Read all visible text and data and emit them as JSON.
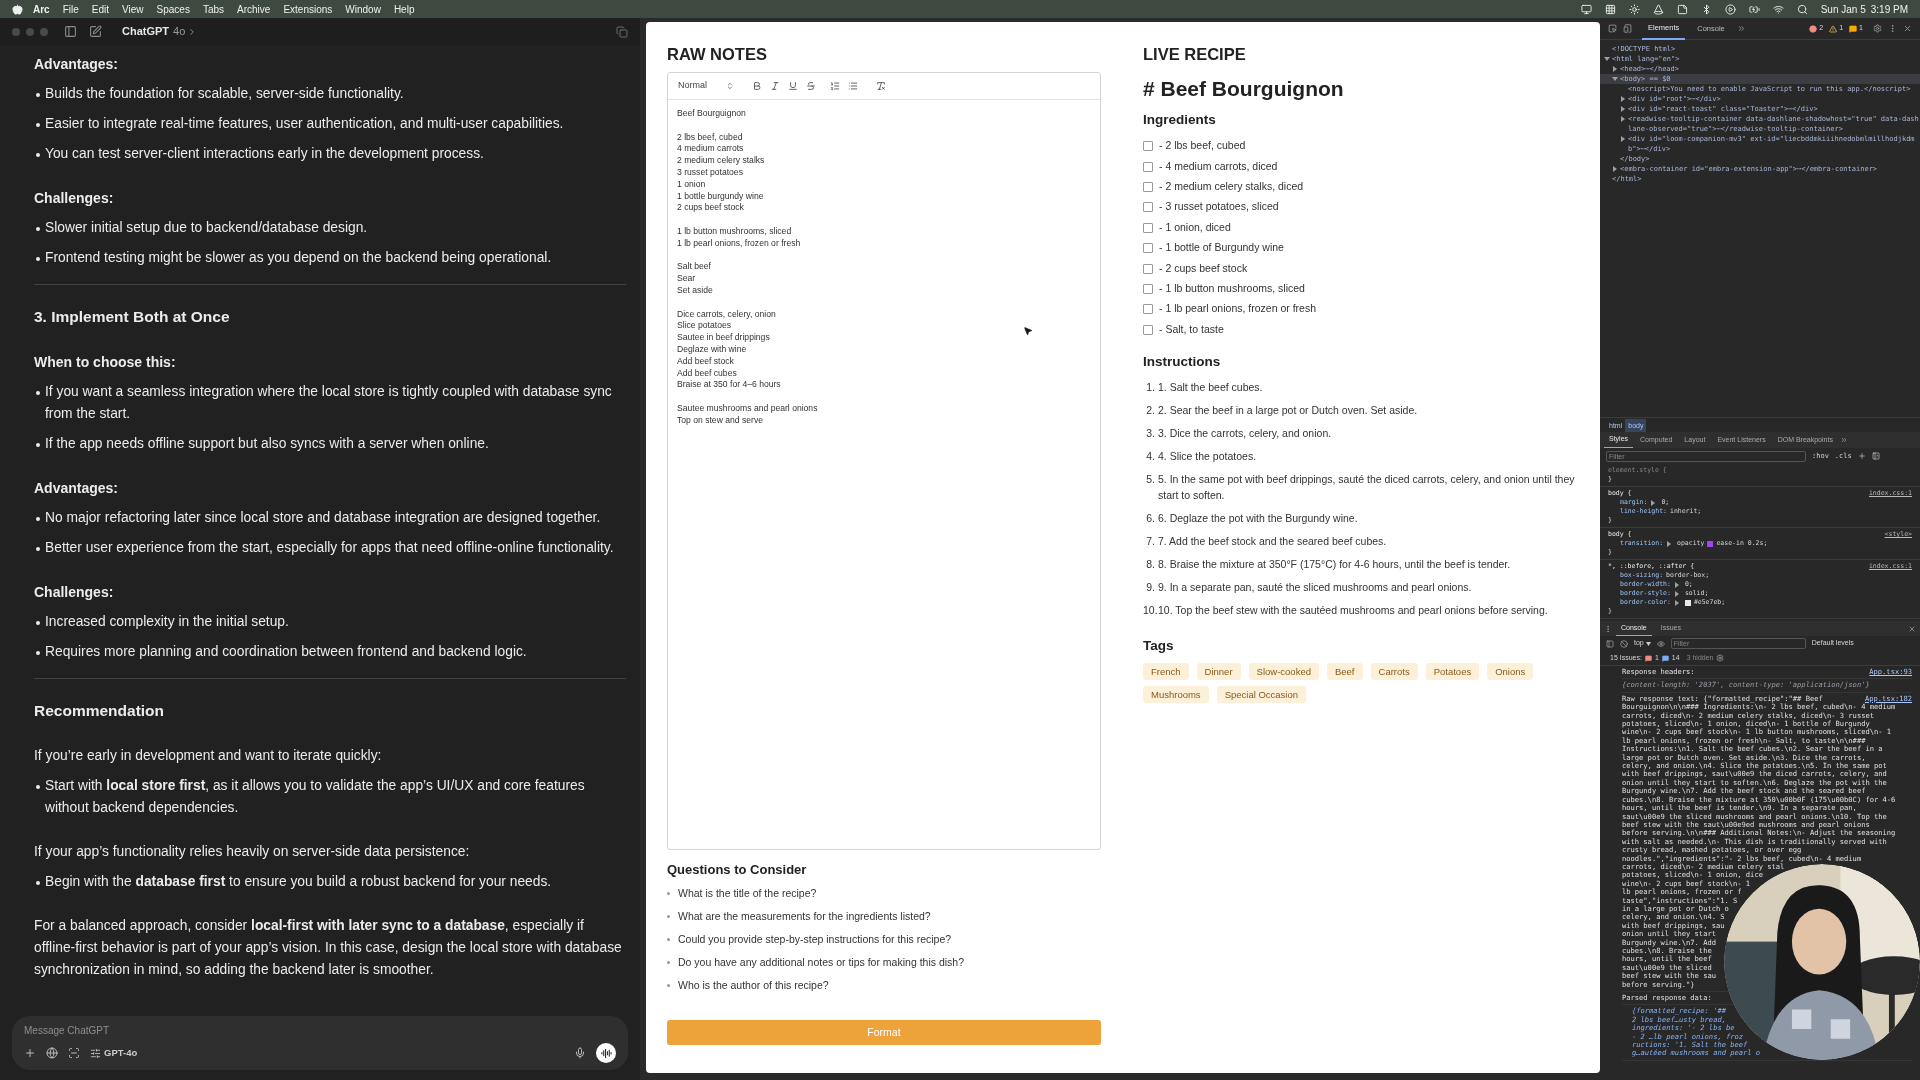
{
  "menu_bar": {
    "items": [
      {
        "label": "Arc",
        "kind": "app"
      },
      {
        "label": "File",
        "kind": "menu"
      },
      {
        "label": "Edit",
        "kind": "menu"
      },
      {
        "label": "View",
        "kind": "menu"
      },
      {
        "label": "Spaces",
        "kind": "menu"
      },
      {
        "label": "Tabs",
        "kind": "menu"
      },
      {
        "label": "Archive",
        "kind": "menu"
      },
      {
        "label": "Extensions",
        "kind": "menu"
      },
      {
        "label": "Window",
        "kind": "menu"
      },
      {
        "label": "Help",
        "kind": "menu"
      }
    ],
    "date": "Sun Jan 5",
    "time": "3:19 PM"
  },
  "chat": {
    "title": "ChatGPT",
    "model": "4o",
    "blocks": [
      {
        "kind": "label",
        "text": "Advantages:"
      },
      {
        "kind": "bullet",
        "text": "Builds the foundation for scalable, server-side functionality."
      },
      {
        "kind": "bullet",
        "text": "Easier to integrate real-time features, user authentication, and multi-user capabilities."
      },
      {
        "kind": "bullet",
        "text": "You can test server-client interactions early in the development process."
      },
      {
        "kind": "label",
        "text": "Challenges:"
      },
      {
        "kind": "bullet",
        "text": "Slower initial setup due to backend/database design."
      },
      {
        "kind": "bullet",
        "text": "Frontend testing might be slower as you depend on the backend being operational."
      },
      {
        "kind": "divider"
      },
      {
        "kind": "section",
        "text": "3. Implement Both at Once"
      },
      {
        "kind": "label",
        "text": "When to choose this:"
      },
      {
        "kind": "bullet",
        "text": "If you want a seamless integration where the local store is tightly coupled with database sync from the start."
      },
      {
        "kind": "bullet",
        "text": "If the app needs offline support but also syncs with a server when online."
      },
      {
        "kind": "label",
        "text": "Advantages:"
      },
      {
        "kind": "bullet",
        "text": "No major refactoring later since local store and database integration are designed together."
      },
      {
        "kind": "bullet",
        "text": "Better user experience from the start, especially for apps that need offline-online functionality."
      },
      {
        "kind": "label",
        "text": "Challenges:"
      },
      {
        "kind": "bullet",
        "text": "Increased complexity in the initial setup."
      },
      {
        "kind": "bullet",
        "text": "Requires more planning and coordination between frontend and backend logic."
      },
      {
        "kind": "divider"
      },
      {
        "kind": "section",
        "text": "Recommendation"
      },
      {
        "kind": "paragraph",
        "text": "If you’re early in development and want to iterate quickly:"
      },
      {
        "kind": "bullet",
        "text": "Start with **local store first**, as it allows you to validate the app’s UI/UX and core features without backend dependencies."
      },
      {
        "kind": "paragraph",
        "text": "If your app’s functionality relies heavily on server-side data persistence:"
      },
      {
        "kind": "bullet",
        "text": "Begin with the **database first** to ensure you build a robust backend for your needs."
      },
      {
        "kind": "paragraph",
        "text": "For a balanced approach, consider **local-first with later sync to a database**, especially if offline-first behavior is part of your app’s vision. In this case, design the local store with database synchronization in mind, so adding the backend later is smoother."
      }
    ],
    "composer": {
      "placeholder": "Message ChatGPT",
      "model": "GPT-4o"
    }
  },
  "raw_notes": {
    "title": "RAW NOTES",
    "format": "Normal",
    "paragraphs": [
      [
        "Beef Bourguignon"
      ],
      [
        "2 lbs beef, cubed",
        "4 medium carrots",
        "2 medium celery stalks",
        "3 russet potatoes",
        "1 onion",
        "1 bottle burgundy wine",
        "2 cups beef stock"
      ],
      [
        "1 lb button mushrooms, sliced",
        "1 lb pearl onions, frozen or fresh"
      ],
      [
        "Salt beef",
        "Sear",
        "Set aside"
      ],
      [
        "Dice carrots, celery, onion",
        "Slice potatoes",
        "Sautee in beef drippings",
        "Deglaze with wine",
        "Add beef stock",
        "Add beef cubes",
        "Braise at 350 for 4–6 hours"
      ],
      [
        "Sautee mushrooms and pearl onions",
        "Top on stew and serve"
      ]
    ]
  },
  "questions": {
    "title": "Questions to Consider",
    "items": [
      "What is the title of the recipe?",
      "What are the measurements for the ingredients listed?",
      "Could you provide step-by-step instructions for this recipe?",
      "Do you have any additional notes or tips for making this dish?",
      "Who is the author of this recipe?"
    ]
  },
  "format_button": "Format",
  "live_recipe": {
    "title": "LIVE RECIPE",
    "heading": "# Beef Bourguignon",
    "ingredients_title": "Ingredients",
    "ingredients": [
      {
        "label": "- 2 lbs beef, cubed",
        "checked": false
      },
      {
        "label": "- 4 medium carrots, diced",
        "checked": false
      },
      {
        "label": "- 2 medium celery stalks, diced",
        "checked": false
      },
      {
        "label": "- 3 russet potatoes, sliced",
        "checked": false
      },
      {
        "label": "- 1 onion, diced",
        "checked": false
      },
      {
        "label": "- 1 bottle of Burgundy wine",
        "checked": false
      },
      {
        "label": "- 2 cups beef stock",
        "checked": false
      },
      {
        "label": "- 1 lb button mushrooms, sliced",
        "checked": false
      },
      {
        "label": "- 1 lb pearl onions, frozen or fresh",
        "checked": false
      },
      {
        "label": "- Salt, to taste",
        "checked": false
      }
    ],
    "instructions_title": "Instructions",
    "instructions": [
      {
        "number": "1.",
        "text": "1. Salt the beef cubes."
      },
      {
        "number": "2.",
        "text": "2. Sear the beef in a large pot or Dutch oven. Set aside."
      },
      {
        "number": "3.",
        "text": "3. Dice the carrots, celery, and onion."
      },
      {
        "number": "4.",
        "text": "4. Slice the potatoes."
      },
      {
        "number": "5.",
        "text": "5. In the same pot with beef drippings, sauté the diced carrots, celery, and onion until they start to soften."
      },
      {
        "number": "6.",
        "text": "6. Deglaze the pot with the Burgundy wine."
      },
      {
        "number": "7.",
        "text": "7. Add the beef stock and the seared beef cubes."
      },
      {
        "number": "8.",
        "text": "8. Braise the mixture at 350°F (175°C) for 4-6 hours, until the beef is tender."
      },
      {
        "number": "9.",
        "text": "9. In a separate pan, sauté the sliced mushrooms and pearl onions."
      },
      {
        "number": "10.",
        "text": "10. Top the beef stew with the sautéed mushrooms and pearl onions before serving."
      }
    ],
    "tags_title": "Tags",
    "tags": [
      "French",
      "Dinner",
      "Slow-cooked",
      "Beef",
      "Carrots",
      "Potatoes",
      "Onions",
      "Mushrooms",
      "Special Occasion"
    ]
  },
  "devtools": {
    "tabs": [
      {
        "label": "Elements",
        "selected": true
      },
      {
        "label": "Console",
        "selected": false
      }
    ],
    "errors": "2",
    "warnings": "1",
    "infos": "1",
    "nodes": [
      {
        "text": "<!DOCTYPE html>"
      },
      {
        "text": "<html lang=\"en\">",
        "expanded": true,
        "close": "</html>",
        "children": [
          {
            "text": "<head>⋯</head>",
            "expanded": false
          },
          {
            "text": "<body> == $0",
            "expanded": true,
            "selected": true,
            "close": "</body>",
            "children": [
              {
                "text": "<noscript>You need to enable JavaScript to run this app.</noscript>"
              },
              {
                "text": "<div id=\"root\">⋯</div>",
                "expanded": false
              },
              {
                "text": "<div id=\"react-toast\" class=\"Toaster\">⋯</div>",
                "expanded": false
              },
              {
                "text": "<readwise-tooltip-container data-dashlane-shadowhost=\"true\" data-dashlane-observed=\"true\">⋯</readwise-tooltip-container>",
                "expanded": false
              },
              {
                "text": "<div id=\"loom-companion-mv3\" ext-id=\"liecbddmkiiihnedobmlmillhodjkdmb\">⋯</div>",
                "expanded": false
              }
            ]
          },
          {
            "text": "<embra-container id=\"embra-extension-app\">⋯</embra-container>",
            "expanded": false
          }
        ]
      }
    ],
    "breadcrumbs": [
      {
        "label": "html",
        "selected": false
      },
      {
        "label": "body",
        "selected": true
      }
    ],
    "style_tabs": [
      {
        "label": "Styles",
        "selected": true
      },
      {
        "label": "Computed",
        "selected": false
      },
      {
        "label": "Layout",
        "selected": false
      },
      {
        "label": "Event Listeners",
        "selected": false
      },
      {
        "label": "DOM Breakpoints",
        "selected": false
      }
    ],
    "filter": {
      "placeholder": "Filter"
    },
    "hov": ":hov",
    "cls": ".cls",
    "rules": [
      {
        "selector": "element.style {",
        "close": "}",
        "muted": true
      },
      {
        "selector": "body {",
        "source": "index.css:1",
        "close": "}",
        "props": [
          {
            "kind": "plain",
            "name": "margin:",
            "value": "0;",
            "expandable": true
          },
          {
            "kind": "plain",
            "name": "line-height:",
            "value": "inherit;"
          }
        ]
      },
      {
        "selector": "body {",
        "source": "<style>",
        "close": "}",
        "props": [
          {
            "kind": "easing",
            "name": "transition:",
            "pre": "opacity",
            "value": "ease-in 0.2s;",
            "expandable": true
          }
        ]
      },
      {
        "selector": "*, ::before, ::after {",
        "source": "index.css:1",
        "close": "}",
        "props": [
          {
            "kind": "plain",
            "name": "box-sizing:",
            "value": "border-box;"
          },
          {
            "kind": "plain",
            "name": "border-width:",
            "value": "0;",
            "expandable": true
          },
          {
            "kind": "plain",
            "name": "border-style:",
            "value": "solid;",
            "expandable": true
          },
          {
            "kind": "color",
            "name": "border-color:",
            "value": "#e5e7eb;",
            "expandable": true
          }
        ]
      }
    ],
    "console_tabs": [
      {
        "label": "Console",
        "selected": true
      },
      {
        "label": "Issues",
        "selected": false
      }
    ],
    "context": "top",
    "console_filter": {
      "placeholder": "Filter"
    },
    "levels": "Default levels",
    "issues": "15 Issues:",
    "issue_errors": "1",
    "issue_infos": "14",
    "hidden": "3 hidden",
    "messages": [
      {
        "kind": "log",
        "lines": [
          "Response headers:"
        ],
        "source": "App.tsx:93"
      },
      {
        "kind": "object",
        "lines": [
          "{content-length: '2037', content-type: 'application/json'}"
        ]
      },
      {
        "kind": "log",
        "source": "App.tsx:182",
        "lines": [
          "Raw response text: {\"formatted_recipe\":\"## Beef",
          "Bourguignon\\n\\n### Ingredients:\\n- 2 lbs beef, cubed\\n- 4 medium",
          "carrots, diced\\n- 2 medium celery stalks, diced\\n- 3 russet",
          "potatoes, sliced\\n- 1 onion, diced\\n- 1 bottle of Burgundy",
          "wine\\n- 2 cups beef stock\\n- 1 lb button mushrooms, sliced\\n- 1",
          "lb pearl onions, frozen or fresh\\n- Salt, to taste\\n\\n###",
          "Instructions:\\n1. Salt the beef cubes.\\n2. Sear the beef in a",
          "large pot or Dutch oven. Set aside.\\n3. Dice the carrots,",
          "celery, and onion.\\n4. Slice the potatoes.\\n5. In the same pot",
          "with beef drippings, saut\\u00e9 the diced carrots, celery, and",
          "onion until they start to soften.\\n6. Deglaze the pot with the",
          "Burgundy wine.\\n7. Add the beef stock and the seared beef",
          "cubes.\\n8. Braise the mixture at 350\\u00b0F (175\\u00b0C) for 4-6",
          "hours, until the beef is tender.\\n9. In a separate pan,",
          "saut\\u00e9 the sliced mushrooms and pearl onions.\\n10. Top the",
          "beef stew with the saut\\u00e9ed mushrooms and pearl onions",
          "before serving.\\n\\n### Additional Notes:\\n- Adjust the seasoning",
          "with salt as needed.\\n- This dish is traditionally served with",
          "crusty bread, mashed potatoes, or over egg",
          "noodles.\",\"ingredients\":\"- 2 lbs beef, cubed\\n- 4 medium",
          "carrots, diced\\n- 2 medium celery stal",
          "potatoes, sliced\\n- 1 onion, dice",
          "wine\\n- 2 cups beef stock\\n- 1",
          "lb pearl onions, frozen or f",
          "taste\",\"instructions\":\"1. S",
          "in a large pot or Dutch o",
          "celery, and onion.\\n4. S",
          "with beef drippings, sau",
          "onion until they start",
          "Burgundy wine.\\n7. Add",
          "cubes.\\n8. Braise the",
          "hours, until the beef",
          "saut\\u00e9 the sliced",
          "beef stew with the sau",
          "before serving.\"}"
        ]
      },
      {
        "kind": "log",
        "lines": [
          "Parsed response data:"
        ]
      },
      {
        "kind": "parsed",
        "lines": [
          "{formatted_recipe: '##",
          "2 lbs beef…usty bread,",
          "ingredients: '- 2 lbs be",
          "- 2 …lb pearl onions, froz",
          "ructions: '1. Salt the beef",
          "g…autéed mushrooms and pearl o"
        ]
      }
    ]
  }
}
